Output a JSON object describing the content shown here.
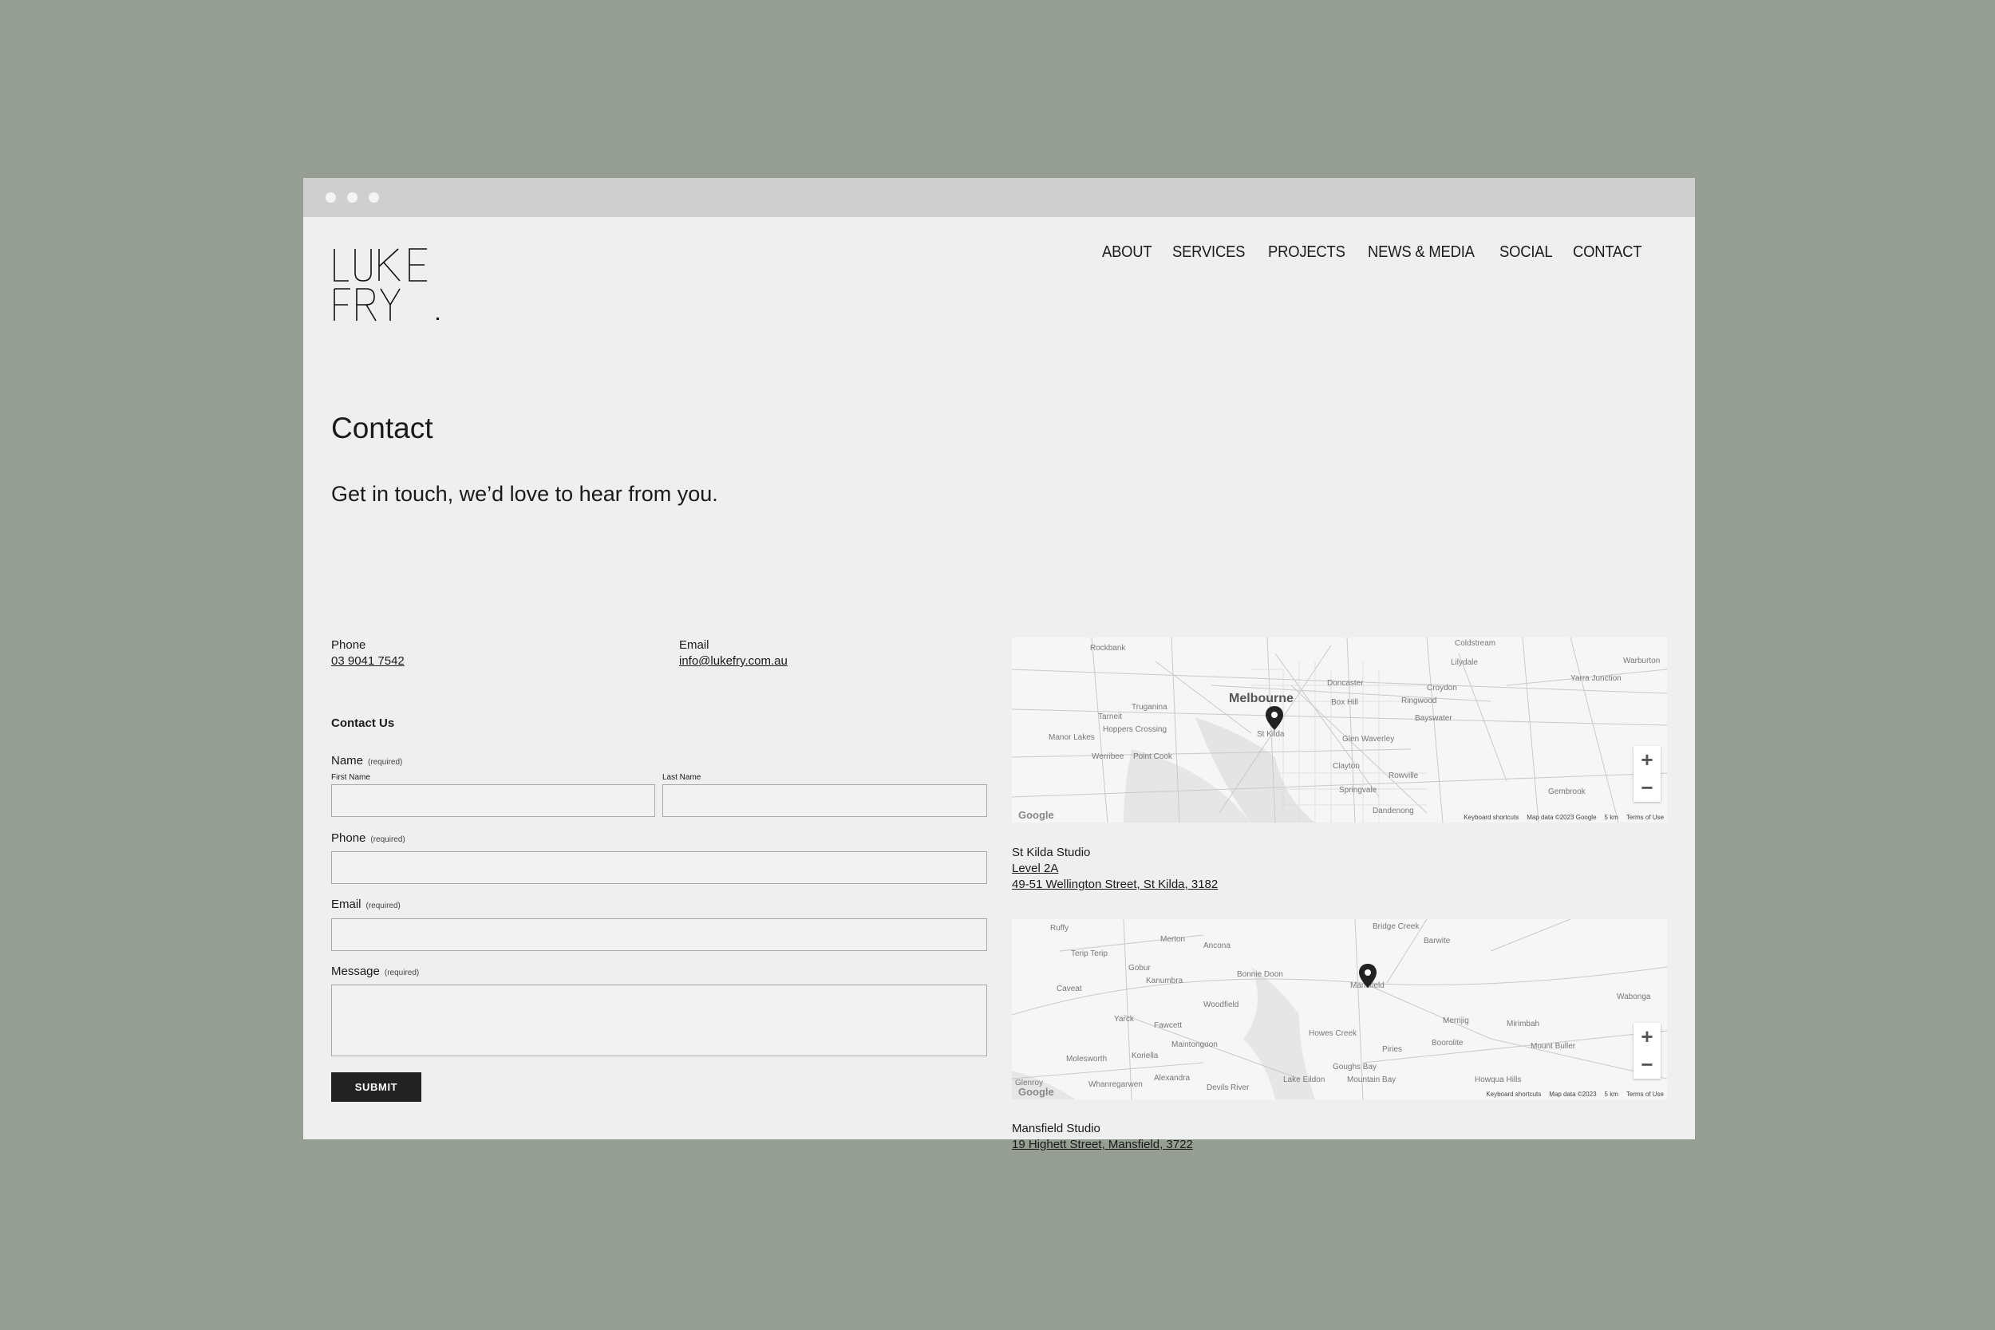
{
  "logo": {
    "line1": "LUKE",
    "line2": "FRY",
    "dot": "."
  },
  "nav": [
    "ABOUT",
    "SERVICES",
    "PROJECTS",
    "NEWS & MEDIA",
    "SOCIAL",
    "CONTACT"
  ],
  "page": {
    "title": "Contact",
    "subtitle": "Get in touch, we’d love to hear from you."
  },
  "info": {
    "phone_label": "Phone",
    "phone_value": "03 9041 7542",
    "email_label": "Email",
    "email_value": "info@lukefry.com.au"
  },
  "form": {
    "heading": "Contact Us",
    "required": "(required)",
    "name_label": "Name",
    "first_name": "First Name",
    "last_name": "Last Name",
    "phone_label": "Phone",
    "email_label": "Email",
    "message_label": "Message",
    "submit": "SUBMIT"
  },
  "map1": {
    "city": "Melbourne",
    "places": [
      "Rockbank",
      "Coldstream",
      "Lilydale",
      "Warburton",
      "Yarra Junction",
      "Doncaster",
      "Box Hill",
      "Ringwood",
      "Croydon",
      "Bayswater",
      "Truganina",
      "Tarneit",
      "Hoppers Crossing",
      "Manor Lakes",
      "Werribee",
      "Point Cook",
      "St Kilda",
      "Glen Waverley",
      "Clayton",
      "Rowville",
      "Springvale",
      "Gembrook",
      "Dandenong"
    ],
    "footer": [
      "Keyboard shortcuts",
      "Map data ©2023 Google",
      "5 km",
      "Terms of Use"
    ]
  },
  "studio1": {
    "name": "St Kilda Studio",
    "line1": "Level 2A",
    "line2": "49-51 Wellington Street, St Kilda, 3182"
  },
  "map2": {
    "places": [
      "Ruffy",
      "Merton",
      "Ancona",
      "Bridge Creek",
      "Barwite",
      "Terip Terip",
      "Gobur",
      "Kanumbra",
      "Bonnie Doon",
      "Mansfield",
      "Caveat",
      "Woodfield",
      "Wabonga",
      "Yarck",
      "Fawcett",
      "Merrijig",
      "Mirimbah",
      "Maintongoon",
      "Howes Creek",
      "Boorolite",
      "Mount Buller",
      "Molesworth",
      "Koriella",
      "Piries",
      "Goughs Bay",
      "Alexandra",
      "Whanregarwen",
      "Devils River",
      "Lake Eildon",
      "Mountain Bay",
      "Howqua Hills",
      "Glenroy"
    ],
    "footer": [
      "Keyboard shortcuts",
      "Map data ©2023",
      "5 km",
      "Terms of Use"
    ]
  },
  "studio2": {
    "name": "Mansfield Studio",
    "line1": "19 Highett Street, Mansfield, 3722"
  },
  "map_common": {
    "google": "Google",
    "zoom_in": "+",
    "zoom_out": "−"
  }
}
